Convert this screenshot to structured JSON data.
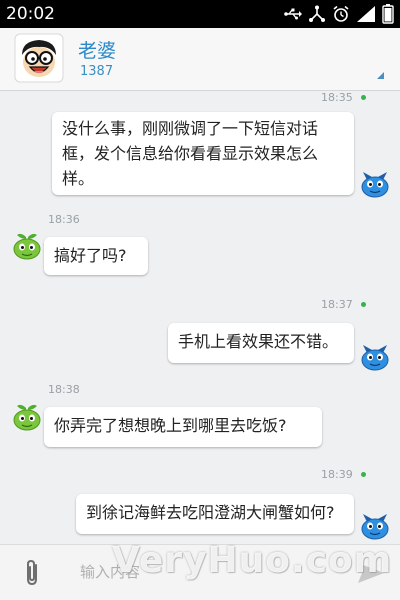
{
  "status_bar": {
    "time": "20:02",
    "icons": [
      "usb-icon",
      "usb-debug-icon",
      "alarm-clock-icon",
      "signal-icon",
      "battery-icon"
    ]
  },
  "header": {
    "contact_name": "老婆",
    "contact_number": "1387"
  },
  "messages": [
    {
      "direction": "out",
      "time": "18:35",
      "lines": [
        "没什么事，刚刚微调了一下短信对话",
        "框，发个信息给你看看显示效果怎么",
        "样。"
      ]
    },
    {
      "direction": "in",
      "time": "18:36",
      "lines": [
        "搞好了吗?"
      ]
    },
    {
      "direction": "out",
      "time": "18:37",
      "lines": [
        "手机上看效果还不错。"
      ]
    },
    {
      "direction": "in",
      "time": "18:38",
      "lines": [
        "你弄完了想想晚上到哪里去吃饭?"
      ]
    },
    {
      "direction": "out",
      "time": "18:39",
      "lines": [
        "到徐记海鲜去吃阳澄湖大闸蟹如何?"
      ]
    }
  ],
  "input_bar": {
    "placeholder": "输入内容",
    "watermark": "VeryHuo.com"
  },
  "colors": {
    "accent": "#2b89c8",
    "sent_dot": "#37b24d",
    "background": "#eef0f2"
  }
}
